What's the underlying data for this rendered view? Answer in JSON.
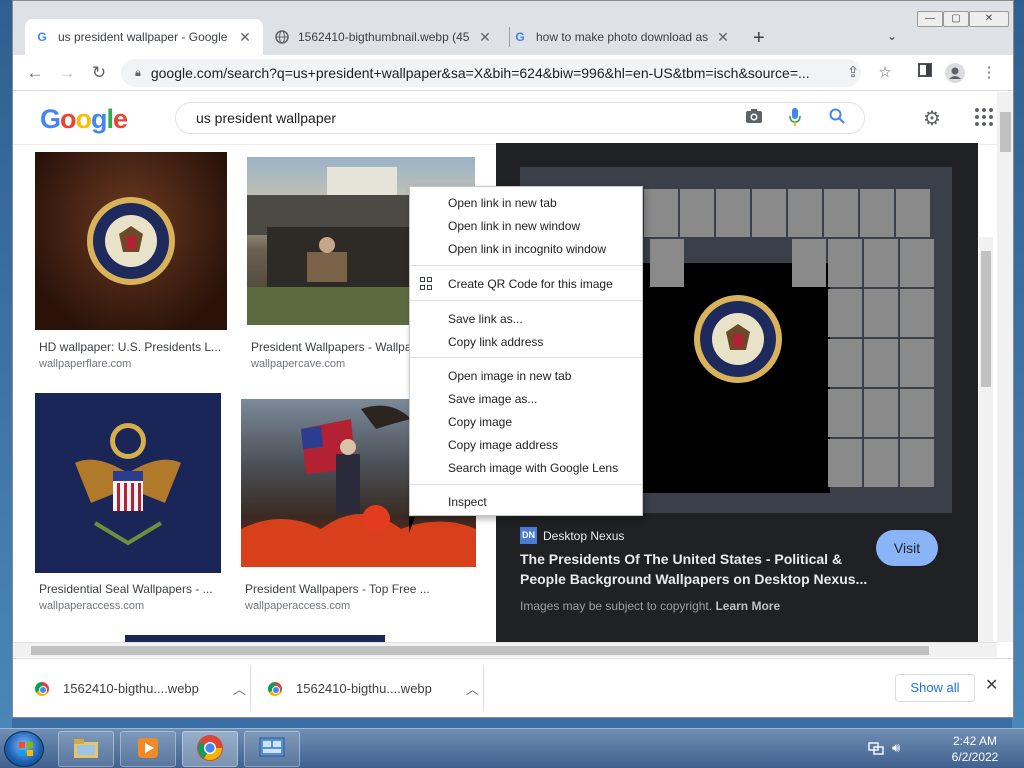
{
  "tabs": [
    {
      "title": "us president wallpaper - Google",
      "favicon": "google-icon",
      "active": true
    },
    {
      "title": "1562410-bigthumbnail.webp (45",
      "favicon": "globe-icon",
      "active": false
    },
    {
      "title": "how to make photo download as",
      "favicon": "google-icon",
      "active": false
    }
  ],
  "window_controls": {
    "minimize": "—",
    "maximize": "▢",
    "close": "✕"
  },
  "toolbar": {
    "url": "google.com/search?q=us+president+wallpaper&sa=X&bih=624&biw=996&hl=en-US&tbm=isch&source=..."
  },
  "google": {
    "logo": [
      "G",
      "o",
      "o",
      "g",
      "l",
      "e"
    ],
    "logo_colors": [
      "#4285f4",
      "#ea4335",
      "#fbbc05",
      "#4285f4",
      "#34a853",
      "#ea4335"
    ],
    "query": "us president wallpaper"
  },
  "results": [
    {
      "title": "HD wallpaper: U.S. Presidents L...",
      "source": "wallpaperflare.com"
    },
    {
      "title": "President Wallpapers - Wallpa",
      "source": "wallpapercave.com"
    },
    {
      "title": "Presidential Seal Wallpapers - ...",
      "source": "wallpaperaccess.com"
    },
    {
      "title": "President Wallpapers - Top Free ...",
      "source": "wallpaperaccess.com"
    }
  ],
  "preview": {
    "source_badge": "DN",
    "source_name": "Desktop Nexus",
    "title": "The Presidents Of The United States - Political & People Background Wallpapers on Desktop Nexus...",
    "visit_label": "Visit",
    "copyright_text": "Images may be subject to copyright.",
    "learn_more": "Learn More"
  },
  "context_menu": {
    "groups": [
      [
        "Open link in new tab",
        "Open link in new window",
        "Open link in incognito window"
      ],
      [
        "Create QR Code for this image"
      ],
      [
        "Save link as...",
        "Copy link address"
      ],
      [
        "Open image in new tab",
        "Save image as...",
        "Copy image",
        "Copy image address",
        "Search image with Google Lens"
      ],
      [
        "Inspect"
      ]
    ]
  },
  "downloads": {
    "items": [
      {
        "name": "1562410-bigthu....webp"
      },
      {
        "name": "1562410-bigthu....webp"
      }
    ],
    "show_all": "Show all",
    "close": "✕"
  },
  "taskbar": {
    "time": "2:42 AM",
    "date": "6/2/2022"
  },
  "colors": {
    "accent": "#1a73e8",
    "visit_button": "#8ab4f8",
    "preview_bg": "#202124"
  }
}
